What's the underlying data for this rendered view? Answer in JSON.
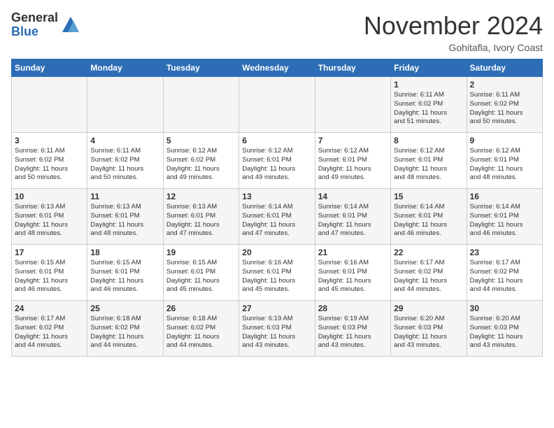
{
  "logo": {
    "general": "General",
    "blue": "Blue"
  },
  "header": {
    "month": "November 2024",
    "location": "Gohitafla, Ivory Coast"
  },
  "weekdays": [
    "Sunday",
    "Monday",
    "Tuesday",
    "Wednesday",
    "Thursday",
    "Friday",
    "Saturday"
  ],
  "weeks": [
    [
      {
        "day": "",
        "info": ""
      },
      {
        "day": "",
        "info": ""
      },
      {
        "day": "",
        "info": ""
      },
      {
        "day": "",
        "info": ""
      },
      {
        "day": "",
        "info": ""
      },
      {
        "day": "1",
        "info": "Sunrise: 6:11 AM\nSunset: 6:02 PM\nDaylight: 11 hours\nand 51 minutes."
      },
      {
        "day": "2",
        "info": "Sunrise: 6:11 AM\nSunset: 6:02 PM\nDaylight: 11 hours\nand 50 minutes."
      }
    ],
    [
      {
        "day": "3",
        "info": "Sunrise: 6:11 AM\nSunset: 6:02 PM\nDaylight: 11 hours\nand 50 minutes."
      },
      {
        "day": "4",
        "info": "Sunrise: 6:11 AM\nSunset: 6:02 PM\nDaylight: 11 hours\nand 50 minutes."
      },
      {
        "day": "5",
        "info": "Sunrise: 6:12 AM\nSunset: 6:02 PM\nDaylight: 11 hours\nand 49 minutes."
      },
      {
        "day": "6",
        "info": "Sunrise: 6:12 AM\nSunset: 6:01 PM\nDaylight: 11 hours\nand 49 minutes."
      },
      {
        "day": "7",
        "info": "Sunrise: 6:12 AM\nSunset: 6:01 PM\nDaylight: 11 hours\nand 49 minutes."
      },
      {
        "day": "8",
        "info": "Sunrise: 6:12 AM\nSunset: 6:01 PM\nDaylight: 11 hours\nand 48 minutes."
      },
      {
        "day": "9",
        "info": "Sunrise: 6:12 AM\nSunset: 6:01 PM\nDaylight: 11 hours\nand 48 minutes."
      }
    ],
    [
      {
        "day": "10",
        "info": "Sunrise: 6:13 AM\nSunset: 6:01 PM\nDaylight: 11 hours\nand 48 minutes."
      },
      {
        "day": "11",
        "info": "Sunrise: 6:13 AM\nSunset: 6:01 PM\nDaylight: 11 hours\nand 48 minutes."
      },
      {
        "day": "12",
        "info": "Sunrise: 6:13 AM\nSunset: 6:01 PM\nDaylight: 11 hours\nand 47 minutes."
      },
      {
        "day": "13",
        "info": "Sunrise: 6:14 AM\nSunset: 6:01 PM\nDaylight: 11 hours\nand 47 minutes."
      },
      {
        "day": "14",
        "info": "Sunrise: 6:14 AM\nSunset: 6:01 PM\nDaylight: 11 hours\nand 47 minutes."
      },
      {
        "day": "15",
        "info": "Sunrise: 6:14 AM\nSunset: 6:01 PM\nDaylight: 11 hours\nand 46 minutes."
      },
      {
        "day": "16",
        "info": "Sunrise: 6:14 AM\nSunset: 6:01 PM\nDaylight: 11 hours\nand 46 minutes."
      }
    ],
    [
      {
        "day": "17",
        "info": "Sunrise: 6:15 AM\nSunset: 6:01 PM\nDaylight: 11 hours\nand 46 minutes."
      },
      {
        "day": "18",
        "info": "Sunrise: 6:15 AM\nSunset: 6:01 PM\nDaylight: 11 hours\nand 46 minutes."
      },
      {
        "day": "19",
        "info": "Sunrise: 6:15 AM\nSunset: 6:01 PM\nDaylight: 11 hours\nand 45 minutes."
      },
      {
        "day": "20",
        "info": "Sunrise: 6:16 AM\nSunset: 6:01 PM\nDaylight: 11 hours\nand 45 minutes."
      },
      {
        "day": "21",
        "info": "Sunrise: 6:16 AM\nSunset: 6:01 PM\nDaylight: 11 hours\nand 45 minutes."
      },
      {
        "day": "22",
        "info": "Sunrise: 6:17 AM\nSunset: 6:02 PM\nDaylight: 11 hours\nand 44 minutes."
      },
      {
        "day": "23",
        "info": "Sunrise: 6:17 AM\nSunset: 6:02 PM\nDaylight: 11 hours\nand 44 minutes."
      }
    ],
    [
      {
        "day": "24",
        "info": "Sunrise: 6:17 AM\nSunset: 6:02 PM\nDaylight: 11 hours\nand 44 minutes."
      },
      {
        "day": "25",
        "info": "Sunrise: 6:18 AM\nSunset: 6:02 PM\nDaylight: 11 hours\nand 44 minutes."
      },
      {
        "day": "26",
        "info": "Sunrise: 6:18 AM\nSunset: 6:02 PM\nDaylight: 11 hours\nand 44 minutes."
      },
      {
        "day": "27",
        "info": "Sunrise: 6:19 AM\nSunset: 6:03 PM\nDaylight: 11 hours\nand 43 minutes."
      },
      {
        "day": "28",
        "info": "Sunrise: 6:19 AM\nSunset: 6:03 PM\nDaylight: 11 hours\nand 43 minutes."
      },
      {
        "day": "29",
        "info": "Sunrise: 6:20 AM\nSunset: 6:03 PM\nDaylight: 11 hours\nand 43 minutes."
      },
      {
        "day": "30",
        "info": "Sunrise: 6:20 AM\nSunset: 6:03 PM\nDaylight: 11 hours\nand 43 minutes."
      }
    ]
  ]
}
